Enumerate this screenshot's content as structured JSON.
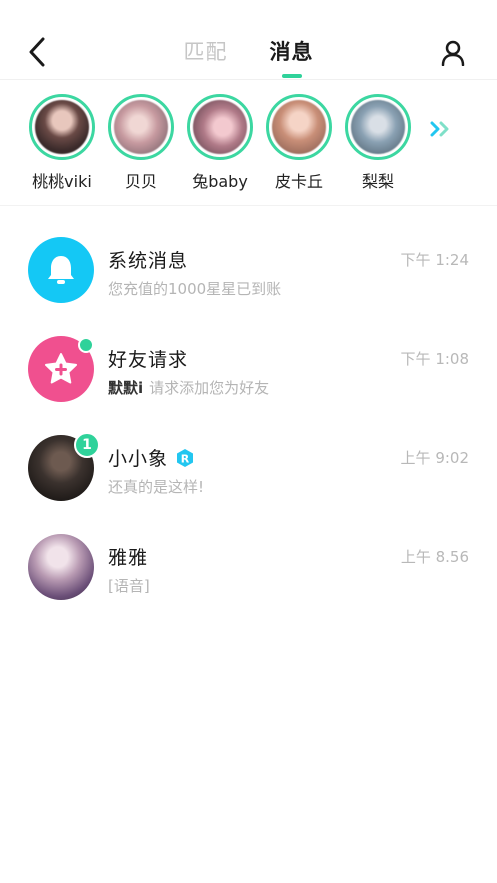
{
  "header": {
    "tabs": [
      {
        "label": "匹配",
        "active": false
      },
      {
        "label": "消息",
        "active": true
      }
    ]
  },
  "stories": [
    {
      "name": "桃桃viki"
    },
    {
      "name": "贝贝"
    },
    {
      "name": "兔baby"
    },
    {
      "name": "皮卡丘"
    },
    {
      "name": "梨梨"
    }
  ],
  "messages": [
    {
      "title": "系统消息",
      "time": "下午 1:24",
      "preview": "您充值的1000星星已到账"
    },
    {
      "title": "好友请求",
      "time": "下午 1:08",
      "sender": "默默i",
      "preview": "请求添加您为好友"
    },
    {
      "title": "小小象",
      "time": "上午 9:02",
      "preview": "还真的是这样!",
      "unread": "1",
      "badge": "R"
    },
    {
      "title": "雅雅",
      "time": "上午 8.56",
      "preview": "[语音]"
    }
  ],
  "colors": {
    "accent": "#2fd29a",
    "system_icon_bg": "#14c8f5",
    "friend_icon_bg": "#f0508f"
  }
}
